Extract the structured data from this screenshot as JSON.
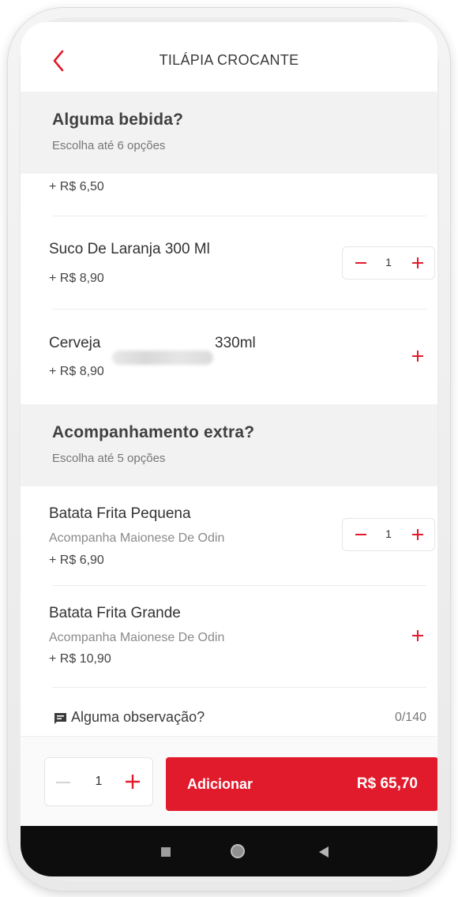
{
  "header": {
    "title": "TILÁPIA CROCANTE"
  },
  "section_drinks": {
    "title": "Alguma bebida?",
    "subtitle": "Escolha até 6 opções"
  },
  "drink_items": [
    {
      "price": "+ R$ 6,50"
    },
    {
      "name": "Suco De Laranja 300 Ml",
      "price": "+ R$ 8,90",
      "qty": "1"
    },
    {
      "name_prefix": "Cerveja",
      "name_suffix": "330ml",
      "price": "+ R$ 8,90"
    }
  ],
  "section_sides": {
    "title": "Acompanhamento extra?",
    "subtitle": "Escolha até 5 opções"
  },
  "side_items": [
    {
      "name": "Batata Frita Pequena",
      "description": "Acompanha Maionese De Odin",
      "price": "+ R$ 6,90",
      "qty": "1"
    },
    {
      "name": "Batata Frita Grande",
      "description": "Acompanha Maionese De Odin",
      "price": "+ R$ 10,90"
    }
  ],
  "observation": {
    "label": "Alguma observação?",
    "counter": "0/140"
  },
  "footer": {
    "qty": "1",
    "add_label": "Adicionar",
    "total": "R$ 65,70"
  },
  "colors": {
    "accent": "#e21b2c",
    "section_bg": "#f2f2f2"
  },
  "icons": [
    "back-chevron-icon",
    "minus-icon",
    "plus-icon",
    "comment-icon",
    "square-nav-icon",
    "home-circle-icon",
    "back-triangle-icon"
  ]
}
